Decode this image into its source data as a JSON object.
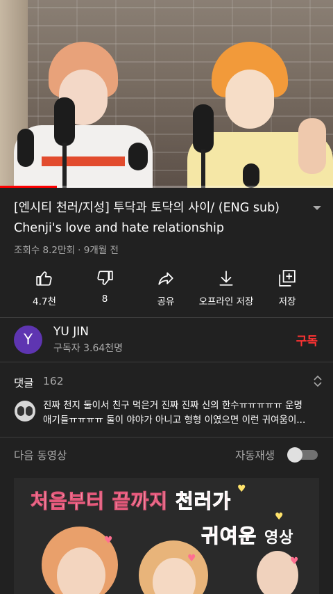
{
  "video": {
    "progress_fraction": 0.17,
    "title": "[엔시티 천러/지성] 투닥과 토닥의 사이/ (ENG sub) Chenji's love and hate relationship",
    "meta": "조회수 8.2만회 · 9개월 전"
  },
  "actions": [
    {
      "icon": "thumbs-up-icon",
      "label": "4.7천"
    },
    {
      "icon": "thumbs-down-icon",
      "label": "8"
    },
    {
      "icon": "share-icon",
      "label": "공유"
    },
    {
      "icon": "download-icon",
      "label": "오프라인 저장"
    },
    {
      "icon": "playlist-add-icon",
      "label": "저장"
    }
  ],
  "channel": {
    "avatar_letter": "Y",
    "avatar_color": "#5e35b1",
    "name": "YU JIN",
    "subscribers": "구독자 3.64천명",
    "subscribe_label": "구독",
    "subscribe_color": "#ff3333"
  },
  "comments": {
    "label": "댓글",
    "count": "162",
    "top_comment_line1": "진짜 천지 둘이서 친구 먹은거 진짜 진짜 신의 한수ㅠㅠㅠㅠㅠ 운명",
    "top_comment_line2": "애기들ㅠㅠㅠㅠ 둘이 야야가 아니고 형형 이였으면 이런 귀여움이..."
  },
  "up_next": {
    "label": "다음 동영상",
    "autoplay_label": "자동재생",
    "autoplay_on": false,
    "thumbnail": {
      "line1_a": "처음부터 ",
      "line1_b": "끝까지 ",
      "line1_c": "천러가",
      "line2_a": "귀여운 ",
      "line2_b": "영상"
    }
  }
}
